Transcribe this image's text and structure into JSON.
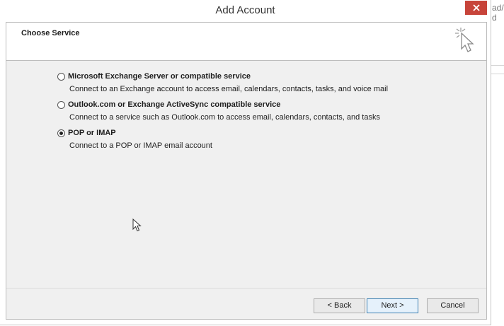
{
  "window": {
    "title": "Add Account",
    "close_label": "close"
  },
  "header": {
    "title": "Choose Service",
    "icon": "wizard-cursor-icon"
  },
  "options": [
    {
      "label": "Microsoft Exchange Server or compatible service",
      "description": "Connect to an Exchange account to access email, calendars, contacts, tasks, and voice mail",
      "selected": false
    },
    {
      "label": "Outlook.com or Exchange ActiveSync compatible service",
      "description": "Connect to a service such as Outlook.com to access email, calendars, contacts, and tasks",
      "selected": false
    },
    {
      "label": "POP or IMAP",
      "description": "Connect to a POP or IMAP email account",
      "selected": true
    }
  ],
  "buttons": {
    "back": "< Back",
    "next": "Next >",
    "cancel": "Cancel"
  },
  "background_app": {
    "line1": "ad/",
    "line2": "d"
  },
  "colors": {
    "close_button": "#c7443a",
    "body_background": "#f0f0f0",
    "default_button_border": "#3c7fb1"
  }
}
